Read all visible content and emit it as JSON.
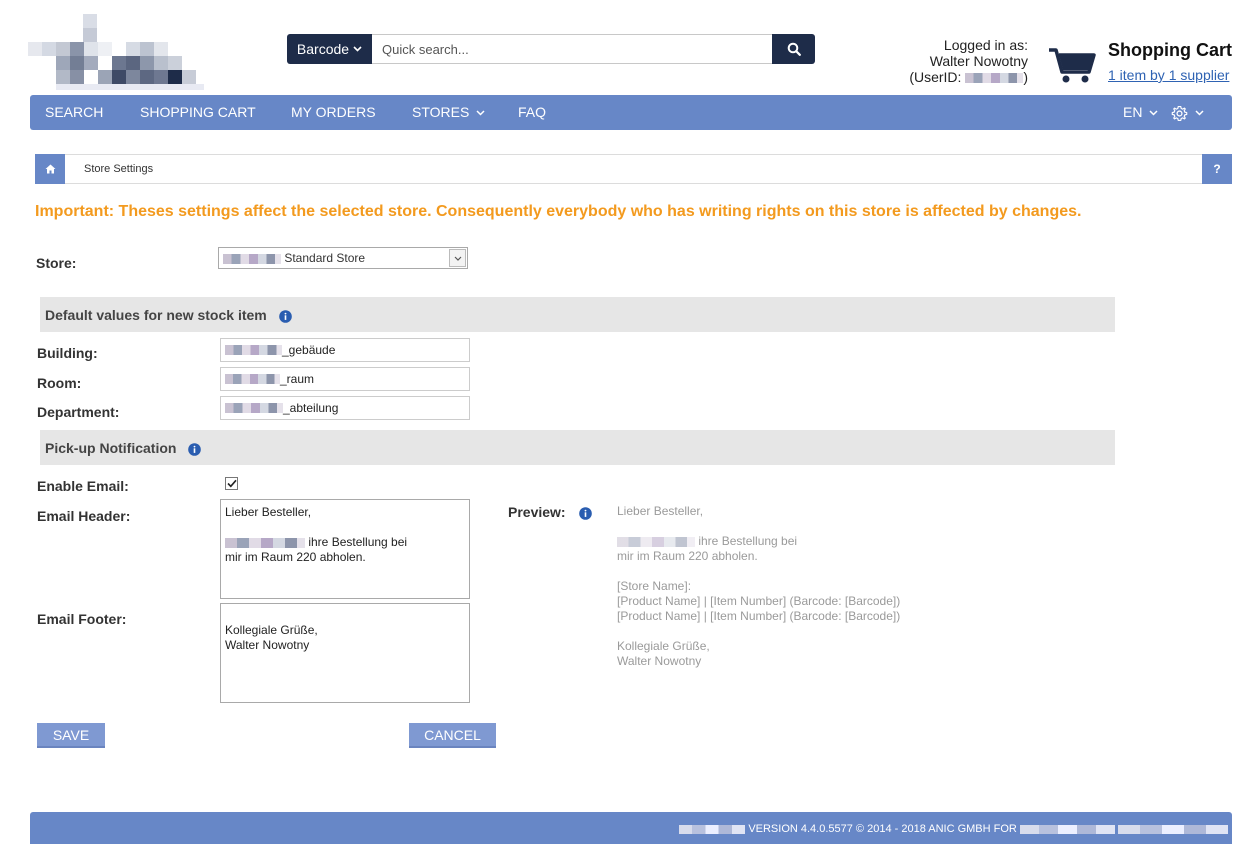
{
  "header": {
    "barcode_label": "Barcode",
    "search_placeholder": "Quick search...",
    "logged_in_as": "Logged in as:",
    "user_name": "Walter Nowotny",
    "user_id_prefix": "(UserID:",
    "user_id_suffix": ")",
    "cart_title": "Shopping Cart",
    "cart_summary": "1 item by 1 supplier"
  },
  "nav": {
    "search": "SEARCH",
    "shopping_cart": "SHOPPING CART",
    "my_orders": "MY ORDERS",
    "stores": "STORES",
    "faq": "FAQ",
    "language": "EN"
  },
  "breadcrumb": {
    "current": "Store Settings",
    "help": "?"
  },
  "important_notice": "Important: Theses settings affect the selected store. Consequently everybody who has writing rights on this store is affected by changes.",
  "store": {
    "label": "Store:",
    "selected_suffix": "Standard Store"
  },
  "defaults_section": {
    "title": "Default values for new stock item",
    "building_label": "Building:",
    "building_suffix": "_gebäude",
    "room_label": "Room:",
    "room_suffix": "_raum",
    "department_label": "Department:",
    "department_suffix": "_abteilung"
  },
  "pickup_section": {
    "title": "Pick-up Notification",
    "enable_email_label": "Enable Email:",
    "enable_email_checked": true,
    "email_header_label": "Email Header:",
    "email_header_line1": "Lieber Besteller,",
    "email_header_line2": "ihre Bestellung bei",
    "email_header_line3": "mir im Raum 220 abholen.",
    "email_footer_label": "Email Footer:",
    "email_footer_text": "Kollegiale Grüße,\nWalter Nowotny",
    "preview_label": "Preview:",
    "preview_line1": "Lieber Besteller,",
    "preview_line2": "ihre Bestellung bei",
    "preview_rest": "mir im Raum 220 abholen.\n\n[Store Name]:\n[Product Name] | [Item Number] (Barcode: [Barcode])\n[Product Name] | [Item Number] (Barcode: [Barcode])\n\nKollegiale Grüße,\nWalter Nowotny"
  },
  "actions": {
    "save": "SAVE",
    "cancel": "CANCEL"
  },
  "footer": {
    "version_text": "VERSION 4.4.0.5577 © 2014 - 2018 ANIC GMBH FOR"
  },
  "colors": {
    "nav_blue": "#6787c7",
    "dark_navy": "#1e2c49",
    "notice_orange": "#f39a1e",
    "link_blue": "#2f63b3"
  }
}
